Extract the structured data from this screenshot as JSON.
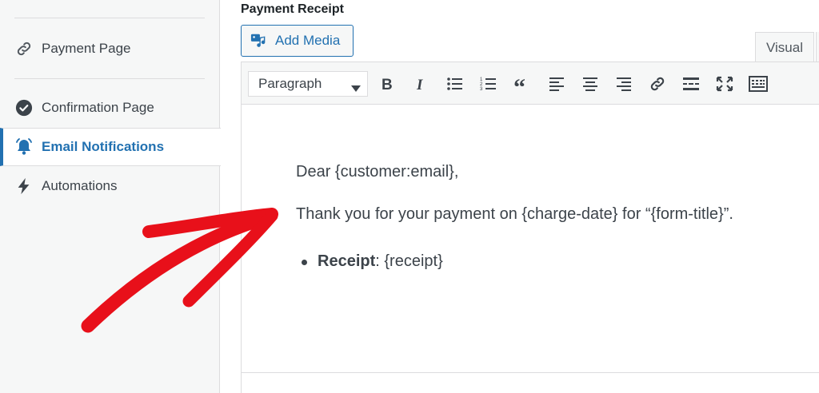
{
  "sidebar": {
    "items": [
      {
        "label": "Payment Page",
        "icon": "link-icon"
      },
      {
        "label": "Confirmation Page",
        "icon": "check-circle-icon"
      },
      {
        "label": "Email Notifications",
        "icon": "bell-icon",
        "active": true
      },
      {
        "label": "Automations",
        "icon": "bolt-icon"
      }
    ]
  },
  "main": {
    "section_title": "Payment Receipt",
    "add_media_label": "Add Media",
    "tab_visual": "Visual",
    "toolbar": {
      "format_value": "Paragraph",
      "buttons": [
        "bold-icon",
        "italic-icon",
        "bullet-list-icon",
        "numbered-list-icon",
        "blockquote-icon",
        "align-left-icon",
        "align-center-icon",
        "align-right-icon",
        "link-icon",
        "read-more-icon",
        "fullscreen-icon",
        "toolbar-toggle-icon"
      ]
    },
    "editor": {
      "line1": "Dear {customer:email},",
      "line2": "Thank you for your payment on {charge-date} for “{form-title}”.",
      "bullet_label": "Receipt",
      "bullet_value": ": {receipt}"
    }
  },
  "colors": {
    "accent": "#2271b1",
    "annotation_arrow": "#e8101a",
    "sidebar_bg": "#f6f7f7"
  }
}
